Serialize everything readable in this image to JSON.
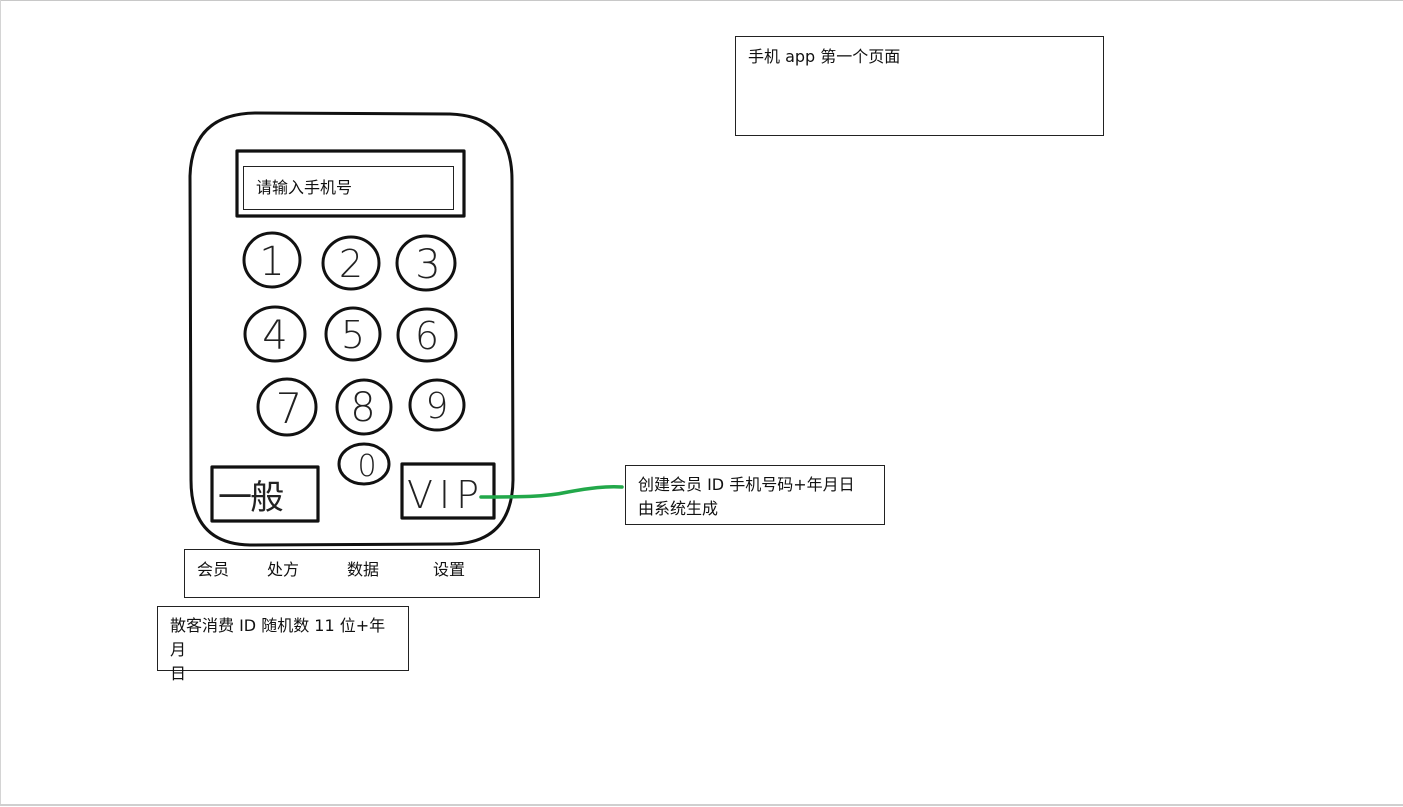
{
  "title_note": {
    "text": "手机 app  第一个页面"
  },
  "phone_input": {
    "placeholder": "请输入手机号"
  },
  "keypad": {
    "keys": [
      "1",
      "2",
      "3",
      "4",
      "5",
      "6",
      "7",
      "8",
      "9",
      "0"
    ]
  },
  "buttons": {
    "general_label": "一般",
    "vip_label": "VIP"
  },
  "vip_note": {
    "line1": "创建会员 ID 手机号码+年月日",
    "line2": "由系统生成"
  },
  "tabbar": {
    "items": [
      "会员",
      "处方",
      "数据",
      "设置"
    ]
  },
  "guest_note": {
    "line1": "散客消费 ID 随机数 11 位+年月",
    "line2": "日"
  },
  "colors": {
    "stroke": "#111111",
    "connector": "#22a84a",
    "background": "#ffffff"
  }
}
